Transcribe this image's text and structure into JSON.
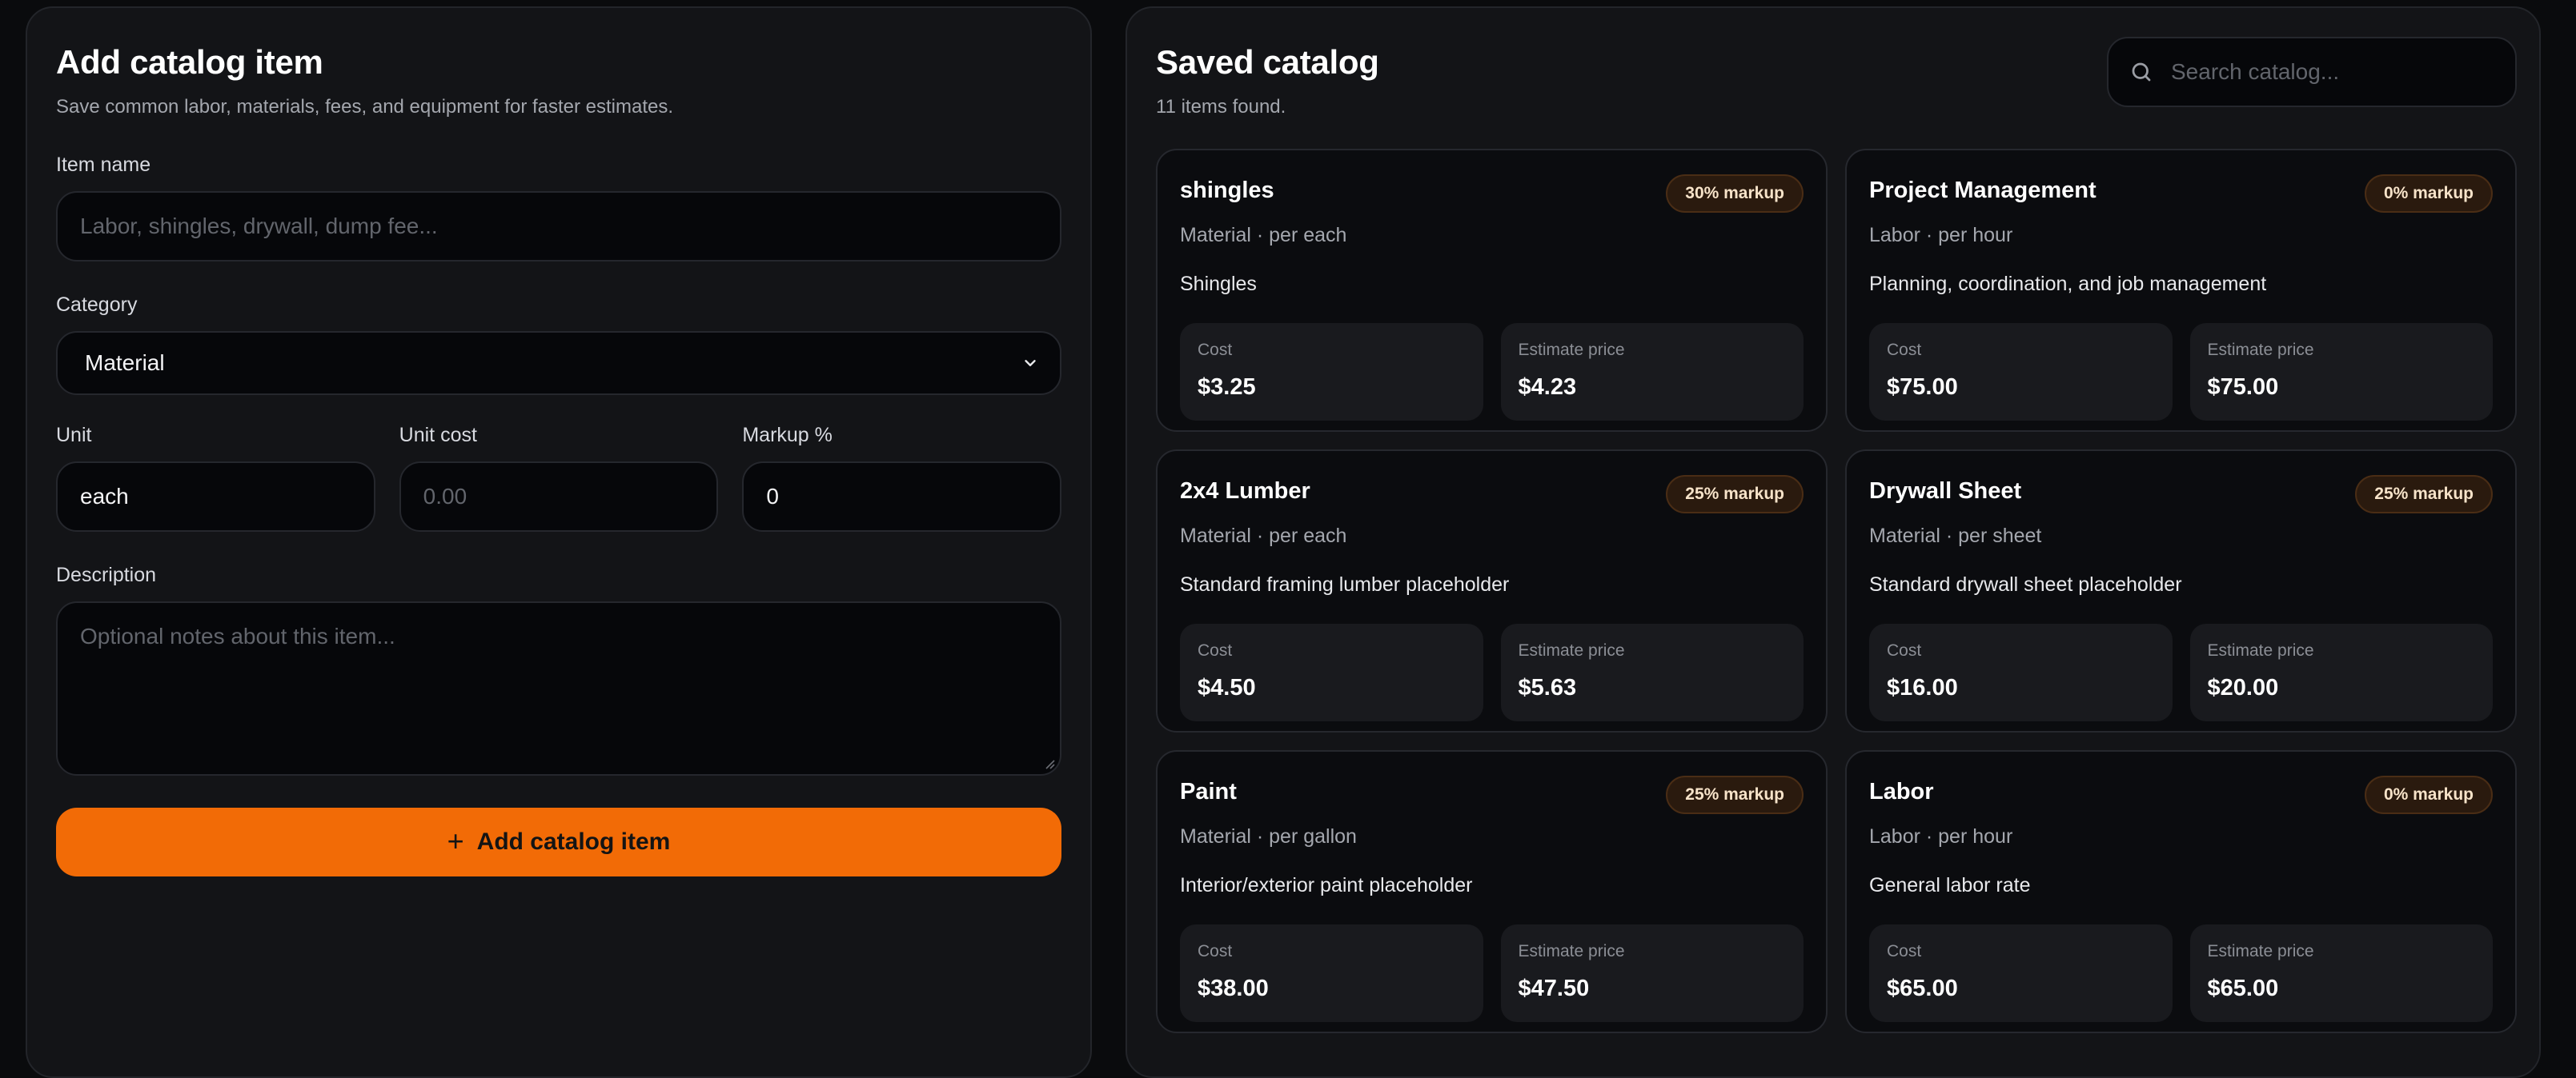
{
  "form": {
    "title": "Add catalog item",
    "subtitle": "Save common labor, materials, fees, and equipment for faster estimates.",
    "item_name_label": "Item name",
    "item_name_placeholder": "Labor, shingles, drywall, dump fee...",
    "category_label": "Category",
    "category_value": "Material",
    "unit_label": "Unit",
    "unit_value": "each",
    "unit_cost_label": "Unit cost",
    "unit_cost_placeholder": "0.00",
    "markup_label": "Markup %",
    "markup_value": "0",
    "description_label": "Description",
    "description_placeholder": "Optional notes about this item...",
    "submit_label": "Add catalog item",
    "accent_color": "#f26b06"
  },
  "catalog": {
    "title": "Saved catalog",
    "count_text": "11 items found.",
    "search_placeholder": "Search catalog...",
    "cost_label": "Cost",
    "price_label": "Estimate price",
    "items": [
      {
        "name": "shingles",
        "badge": "30% markup",
        "meta": "Material · per each",
        "description": "Shingles",
        "cost": "$3.25",
        "price": "$4.23"
      },
      {
        "name": "Project Management",
        "badge": "0% markup",
        "meta": "Labor · per hour",
        "description": "Planning, coordination, and job management",
        "cost": "$75.00",
        "price": "$75.00"
      },
      {
        "name": "2x4 Lumber",
        "badge": "25% markup",
        "meta": "Material · per each",
        "description": "Standard framing lumber placeholder",
        "cost": "$4.50",
        "price": "$5.63"
      },
      {
        "name": "Drywall Sheet",
        "badge": "25% markup",
        "meta": "Material · per sheet",
        "description": "Standard drywall sheet placeholder",
        "cost": "$16.00",
        "price": "$20.00"
      },
      {
        "name": "Paint",
        "badge": "25% markup",
        "meta": "Material · per gallon",
        "description": "Interior/exterior paint placeholder",
        "cost": "$38.00",
        "price": "$47.50"
      },
      {
        "name": "Labor",
        "badge": "0% markup",
        "meta": "Labor · per hour",
        "description": "General labor rate",
        "cost": "$65.00",
        "price": "$65.00"
      }
    ]
  }
}
